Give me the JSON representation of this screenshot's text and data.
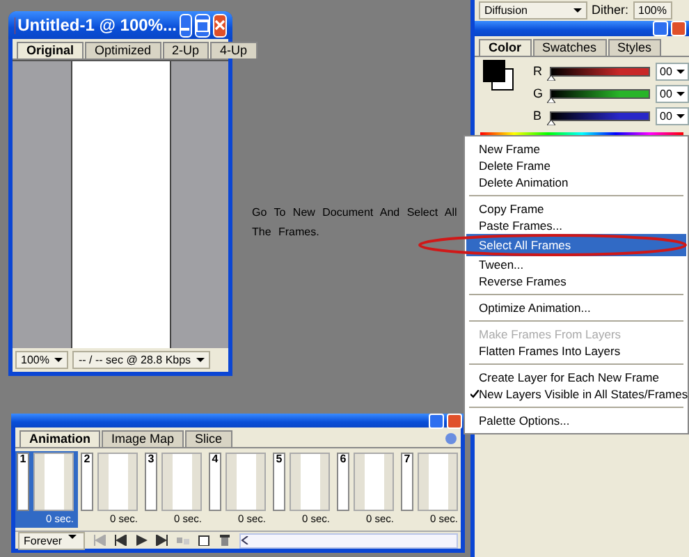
{
  "document_window": {
    "title": "Untitled-1 @ 100%...",
    "tabs": [
      {
        "label": "Original",
        "selected": true
      },
      {
        "label": "Optimized",
        "selected": false
      },
      {
        "label": "2-Up",
        "selected": false
      },
      {
        "label": "4-Up",
        "selected": false
      }
    ],
    "zoom": "100%",
    "status": "-- / -- sec @ 28.8 Kbps"
  },
  "instruction": "Go To New Document And Select All The Frames.",
  "optimize_bar": {
    "dither_method": "Diffusion",
    "dither_label": "Dither:",
    "dither_value": "100%"
  },
  "color_palette": {
    "tabs": [
      {
        "label": "Color",
        "selected": true
      },
      {
        "label": "Swatches",
        "selected": false
      },
      {
        "label": "Styles",
        "selected": false
      }
    ],
    "channels": [
      {
        "label": "R",
        "value": "00",
        "color": "#c82828",
        "level": 0
      },
      {
        "label": "G",
        "value": "00",
        "color": "#28b428",
        "level": 0
      },
      {
        "label": "B",
        "value": "00",
        "color": "#2828c8",
        "level": 0
      }
    ]
  },
  "context_menu": {
    "groups": [
      [
        {
          "label": "New Frame",
          "selected": false,
          "disabled": false,
          "checked": false
        },
        {
          "label": "Delete Frame",
          "selected": false,
          "disabled": false,
          "checked": false
        },
        {
          "label": "Delete Animation",
          "selected": false,
          "disabled": false,
          "checked": false
        }
      ],
      [
        {
          "label": "Copy Frame",
          "selected": false,
          "disabled": false,
          "checked": false
        },
        {
          "label": "Paste Frames...",
          "selected": false,
          "disabled": false,
          "checked": false
        },
        {
          "label": "Select All Frames",
          "selected": true,
          "disabled": false,
          "checked": false
        },
        {
          "label": "Tween...",
          "selected": false,
          "disabled": false,
          "checked": false
        },
        {
          "label": "Reverse Frames",
          "selected": false,
          "disabled": false,
          "checked": false
        }
      ],
      [
        {
          "label": "Optimize Animation...",
          "selected": false,
          "disabled": false,
          "checked": false
        }
      ],
      [
        {
          "label": "Make Frames From Layers",
          "selected": false,
          "disabled": true,
          "checked": false
        },
        {
          "label": "Flatten Frames Into Layers",
          "selected": false,
          "disabled": false,
          "checked": false
        }
      ],
      [
        {
          "label": "Create Layer for Each New Frame",
          "selected": false,
          "disabled": false,
          "checked": false
        },
        {
          "label": "New Layers Visible in All States/Frames",
          "selected": false,
          "disabled": false,
          "checked": true
        }
      ],
      [
        {
          "label": "Palette Options...",
          "selected": false,
          "disabled": false,
          "checked": false
        }
      ]
    ]
  },
  "animation_palette": {
    "tabs": [
      {
        "label": "Animation",
        "selected": true
      },
      {
        "label": "Image Map",
        "selected": false
      },
      {
        "label": "Slice",
        "selected": false
      }
    ],
    "frames": [
      {
        "number": "1",
        "delay": "0 sec.",
        "selected": true
      },
      {
        "number": "2",
        "delay": "0 sec.",
        "selected": false
      },
      {
        "number": "3",
        "delay": "0 sec.",
        "selected": false
      },
      {
        "number": "4",
        "delay": "0 sec.",
        "selected": false
      },
      {
        "number": "5",
        "delay": "0 sec.",
        "selected": false
      },
      {
        "number": "6",
        "delay": "0 sec.",
        "selected": false
      },
      {
        "number": "7",
        "delay": "0 sec.",
        "selected": false
      }
    ],
    "loop": "Forever"
  }
}
